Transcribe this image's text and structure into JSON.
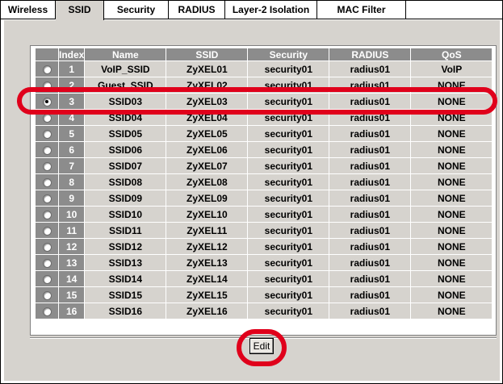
{
  "tabs": [
    {
      "label": "Wireless",
      "active": false
    },
    {
      "label": "SSID",
      "active": true
    },
    {
      "label": "Security",
      "active": false
    },
    {
      "label": "RADIUS",
      "active": false
    },
    {
      "label": "Layer-2 Isolation",
      "active": false
    },
    {
      "label": "MAC Filter",
      "active": false
    }
  ],
  "table": {
    "headers": [
      "Index",
      "Name",
      "SSID",
      "Security",
      "RADIUS",
      "QoS"
    ],
    "rows": [
      {
        "index": "1",
        "name": "VoIP_SSID",
        "ssid": "ZyXEL01",
        "security": "security01",
        "radius": "radius01",
        "qos": "VoIP",
        "selected": false
      },
      {
        "index": "2",
        "name": "Guest_SSID",
        "ssid": "ZyXEL02",
        "security": "security01",
        "radius": "radius01",
        "qos": "NONE",
        "selected": false
      },
      {
        "index": "3",
        "name": "SSID03",
        "ssid": "ZyXEL03",
        "security": "security01",
        "radius": "radius01",
        "qos": "NONE",
        "selected": true
      },
      {
        "index": "4",
        "name": "SSID04",
        "ssid": "ZyXEL04",
        "security": "security01",
        "radius": "radius01",
        "qos": "NONE",
        "selected": false
      },
      {
        "index": "5",
        "name": "SSID05",
        "ssid": "ZyXEL05",
        "security": "security01",
        "radius": "radius01",
        "qos": "NONE",
        "selected": false
      },
      {
        "index": "6",
        "name": "SSID06",
        "ssid": "ZyXEL06",
        "security": "security01",
        "radius": "radius01",
        "qos": "NONE",
        "selected": false
      },
      {
        "index": "7",
        "name": "SSID07",
        "ssid": "ZyXEL07",
        "security": "security01",
        "radius": "radius01",
        "qos": "NONE",
        "selected": false
      },
      {
        "index": "8",
        "name": "SSID08",
        "ssid": "ZyXEL08",
        "security": "security01",
        "radius": "radius01",
        "qos": "NONE",
        "selected": false
      },
      {
        "index": "9",
        "name": "SSID09",
        "ssid": "ZyXEL09",
        "security": "security01",
        "radius": "radius01",
        "qos": "NONE",
        "selected": false
      },
      {
        "index": "10",
        "name": "SSID10",
        "ssid": "ZyXEL10",
        "security": "security01",
        "radius": "radius01",
        "qos": "NONE",
        "selected": false
      },
      {
        "index": "11",
        "name": "SSID11",
        "ssid": "ZyXEL11",
        "security": "security01",
        "radius": "radius01",
        "qos": "NONE",
        "selected": false
      },
      {
        "index": "12",
        "name": "SSID12",
        "ssid": "ZyXEL12",
        "security": "security01",
        "radius": "radius01",
        "qos": "NONE",
        "selected": false
      },
      {
        "index": "13",
        "name": "SSID13",
        "ssid": "ZyXEL13",
        "security": "security01",
        "radius": "radius01",
        "qos": "NONE",
        "selected": false
      },
      {
        "index": "14",
        "name": "SSID14",
        "ssid": "ZyXEL14",
        "security": "security01",
        "radius": "radius01",
        "qos": "NONE",
        "selected": false
      },
      {
        "index": "15",
        "name": "SSID15",
        "ssid": "ZyXEL15",
        "security": "security01",
        "radius": "radius01",
        "qos": "NONE",
        "selected": false
      },
      {
        "index": "16",
        "name": "SSID16",
        "ssid": "ZyXEL16",
        "security": "security01",
        "radius": "radius01",
        "qos": "NONE",
        "selected": false
      }
    ]
  },
  "edit_button": {
    "label": "Edit"
  },
  "colors": {
    "panel_background": "#d6d3ce",
    "header_background": "#8c8c8c",
    "highlight": "#e0001b"
  }
}
